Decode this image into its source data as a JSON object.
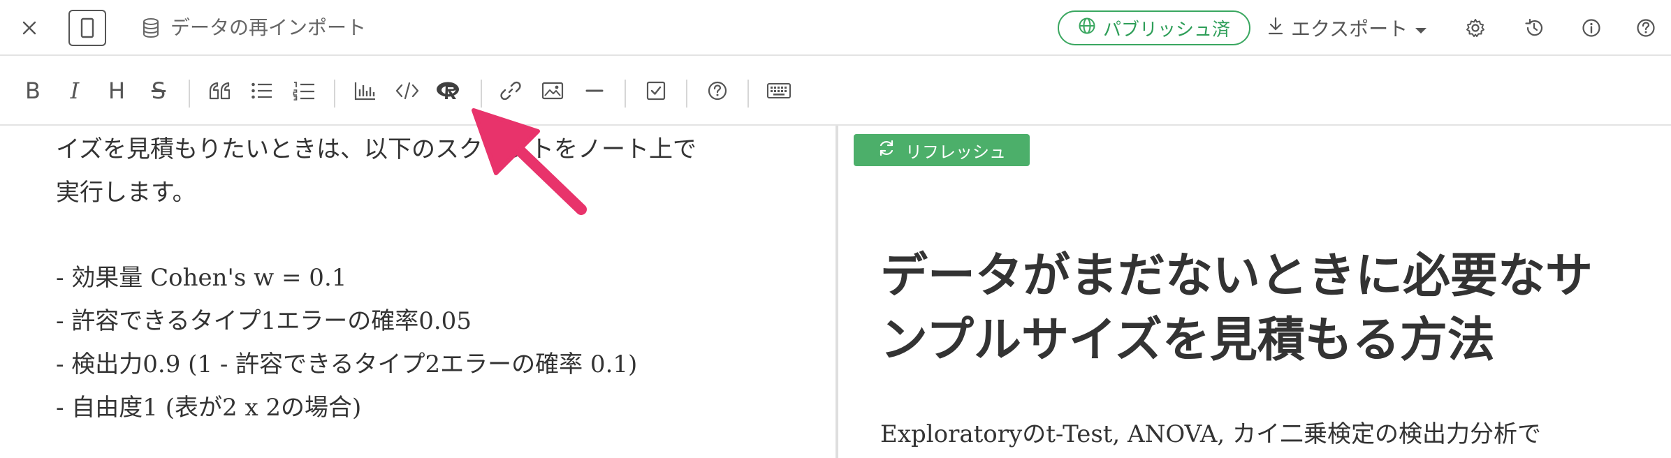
{
  "topbar": {
    "document_title": "データの再インポート",
    "publish_label": "パブリッシュ済",
    "export_label": "エクスポート"
  },
  "toolbar": {
    "bold": "B",
    "italic": "I",
    "heading": "H",
    "strike": "S"
  },
  "editor": {
    "lines": [
      "イズを見積もりたいときは、以下のスクリプトをノート上で",
      "実行します。",
      "",
      "- 効果量 Cohen's w = 0.1",
      "- 許容できるタイプ1エラーの確率0.05",
      "- 検出力0.9 (1 - 許容できるタイプ2エラーの確率 0.1)",
      "- 自由度1 (表が2 x 2の場合)"
    ]
  },
  "preview": {
    "refresh_label": "リフレッシュ",
    "title_line1": "データがまだないときに必要なサ",
    "title_line2": "ンプルサイズを見積もる方法",
    "body_text": "Exploratoryのt-Test, ANOVA, カイ二乗検定の検出力分析で"
  },
  "colors": {
    "accent_green": "#3aa760",
    "refresh_green": "#4caf6a",
    "annotation_arrow": "#e8336b"
  },
  "icons": {
    "close": "close-icon",
    "layout": "single-pane-icon",
    "datasource": "database-icon",
    "publish": "globe-icon",
    "export": "download-icon",
    "export_menu": "caret-down-icon",
    "settings": "gear-icon",
    "history": "history-icon",
    "info": "info-icon",
    "help": "question-icon",
    "refresh": "refresh-icon"
  }
}
